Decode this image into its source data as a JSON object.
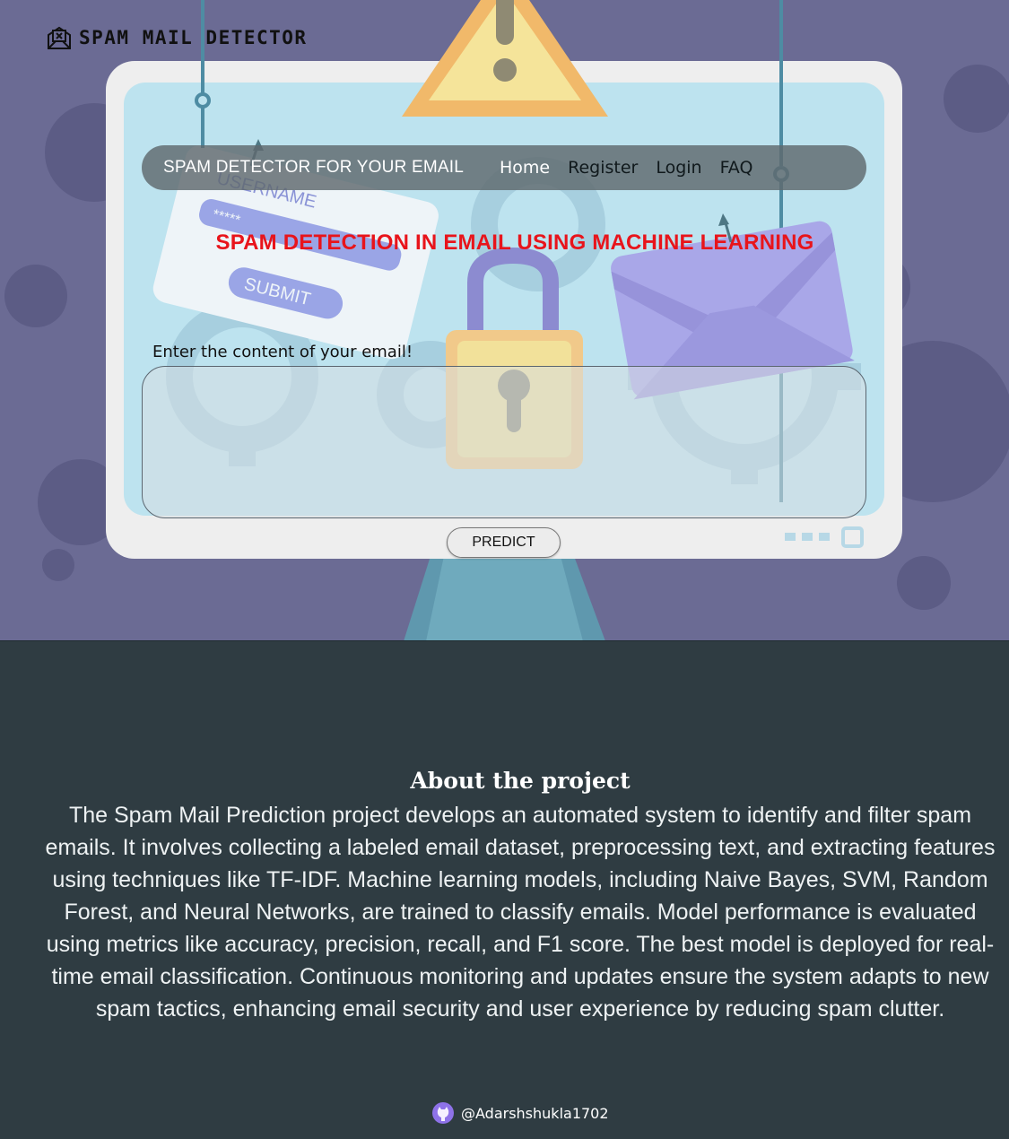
{
  "brand": {
    "name": "SPAM MAIL DETECTOR",
    "icon": "envelope-x-icon"
  },
  "nav": {
    "title": "SPAM DETECTOR FOR YOUR EMAIL",
    "links": [
      "Home",
      "Register",
      "Login",
      "FAQ"
    ]
  },
  "illustration": {
    "username_label": "USERNAME",
    "password_mask": "*****",
    "submit_label": "SUBMIT"
  },
  "main": {
    "headline": "SPAM DETECTION IN EMAIL USING MACHINE LEARNING",
    "field_label": "Enter the content of your email!",
    "email_value": "",
    "predict_label": "PREDICT"
  },
  "about": {
    "title": "About the project",
    "text": "The Spam Mail Prediction project develops an automated system to identify and filter spam emails. It involves collecting a labeled email dataset, preprocessing text, and extracting features using techniques like TF-IDF. Machine learning models, including Naive Bayes, SVM, Random Forest, and Neural Networks, are trained to classify emails. Model performance is evaluated using metrics like accuracy, precision, recall, and F1 score. The best model is deployed for real-time email classification. Continuous monitoring and updates ensure the system adapts to new spam tactics, enhancing email security and user experience by reducing spam clutter."
  },
  "footer": {
    "handle": "@Adarshshukla1702",
    "icon": "github-icon"
  },
  "colors": {
    "hero_bg": "#6b6b94",
    "screen_bg": "#bde3ef",
    "headline": "#e8141b",
    "about_bg": "#2f3c42"
  }
}
